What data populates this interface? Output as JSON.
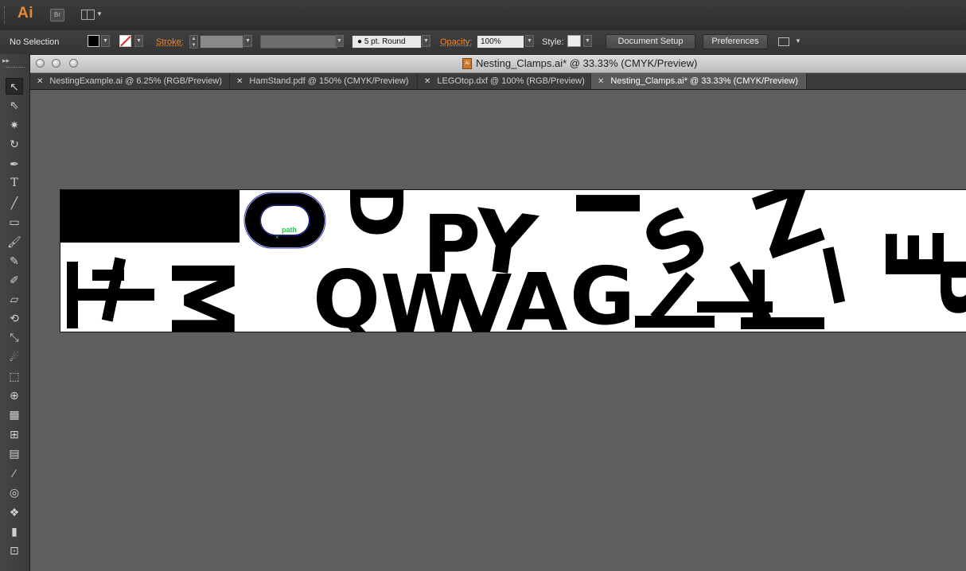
{
  "app": {
    "logo": "Ai",
    "bridge_label": "Br"
  },
  "control_bar": {
    "selection_label": "No Selection",
    "stroke_label": "Stroke:",
    "brush_label": "5 pt. Round",
    "opacity_label": "Opacity:",
    "opacity_value": "100%",
    "style_label": "Style:",
    "document_setup_label": "Document Setup",
    "preferences_label": "Preferences"
  },
  "document": {
    "window_title": "Nesting_Clamps.ai* @ 33.33% (CMYK/Preview)",
    "tabs": [
      {
        "label": "NestingExample.ai @ 6.25% (RGB/Preview)",
        "active": false
      },
      {
        "label": "HamStand.pdf @ 150% (CMYK/Preview)",
        "active": false
      },
      {
        "label": "LEGOtop.dxf @ 100% (RGB/Preview)",
        "active": false
      },
      {
        "label": "Nesting_Clamps.ai* @ 33.33% (CMYK/Preview)",
        "active": true
      }
    ],
    "hover_label": "path"
  },
  "artwork": {
    "top_row": [
      "D",
      "P",
      "Y",
      "I",
      "S",
      "Z",
      "E"
    ],
    "bottom_row": [
      "R",
      "Q",
      "W",
      "V",
      "A",
      "G",
      "B"
    ]
  },
  "colors": {
    "accent_orange": "#e98a33",
    "selection_green": "#1fc74a",
    "selection_blue": "#2a35c8"
  },
  "tools": [
    "selection-tool",
    "direct-selection-tool",
    "magic-wand-tool",
    "lasso-tool",
    "pen-tool",
    "type-tool",
    "line-tool",
    "rectangle-tool",
    "paintbrush-tool",
    "pencil-tool",
    "blob-brush-tool",
    "eraser-tool",
    "rotate-tool",
    "scale-tool",
    "warp-tool",
    "free-transform-tool",
    "shape-builder-tool",
    "perspective-grid-tool",
    "mesh-tool",
    "gradient-tool",
    "eyedropper-tool",
    "blend-tool",
    "symbol-sprayer-tool",
    "column-graph-tool",
    "artboard-tool"
  ]
}
